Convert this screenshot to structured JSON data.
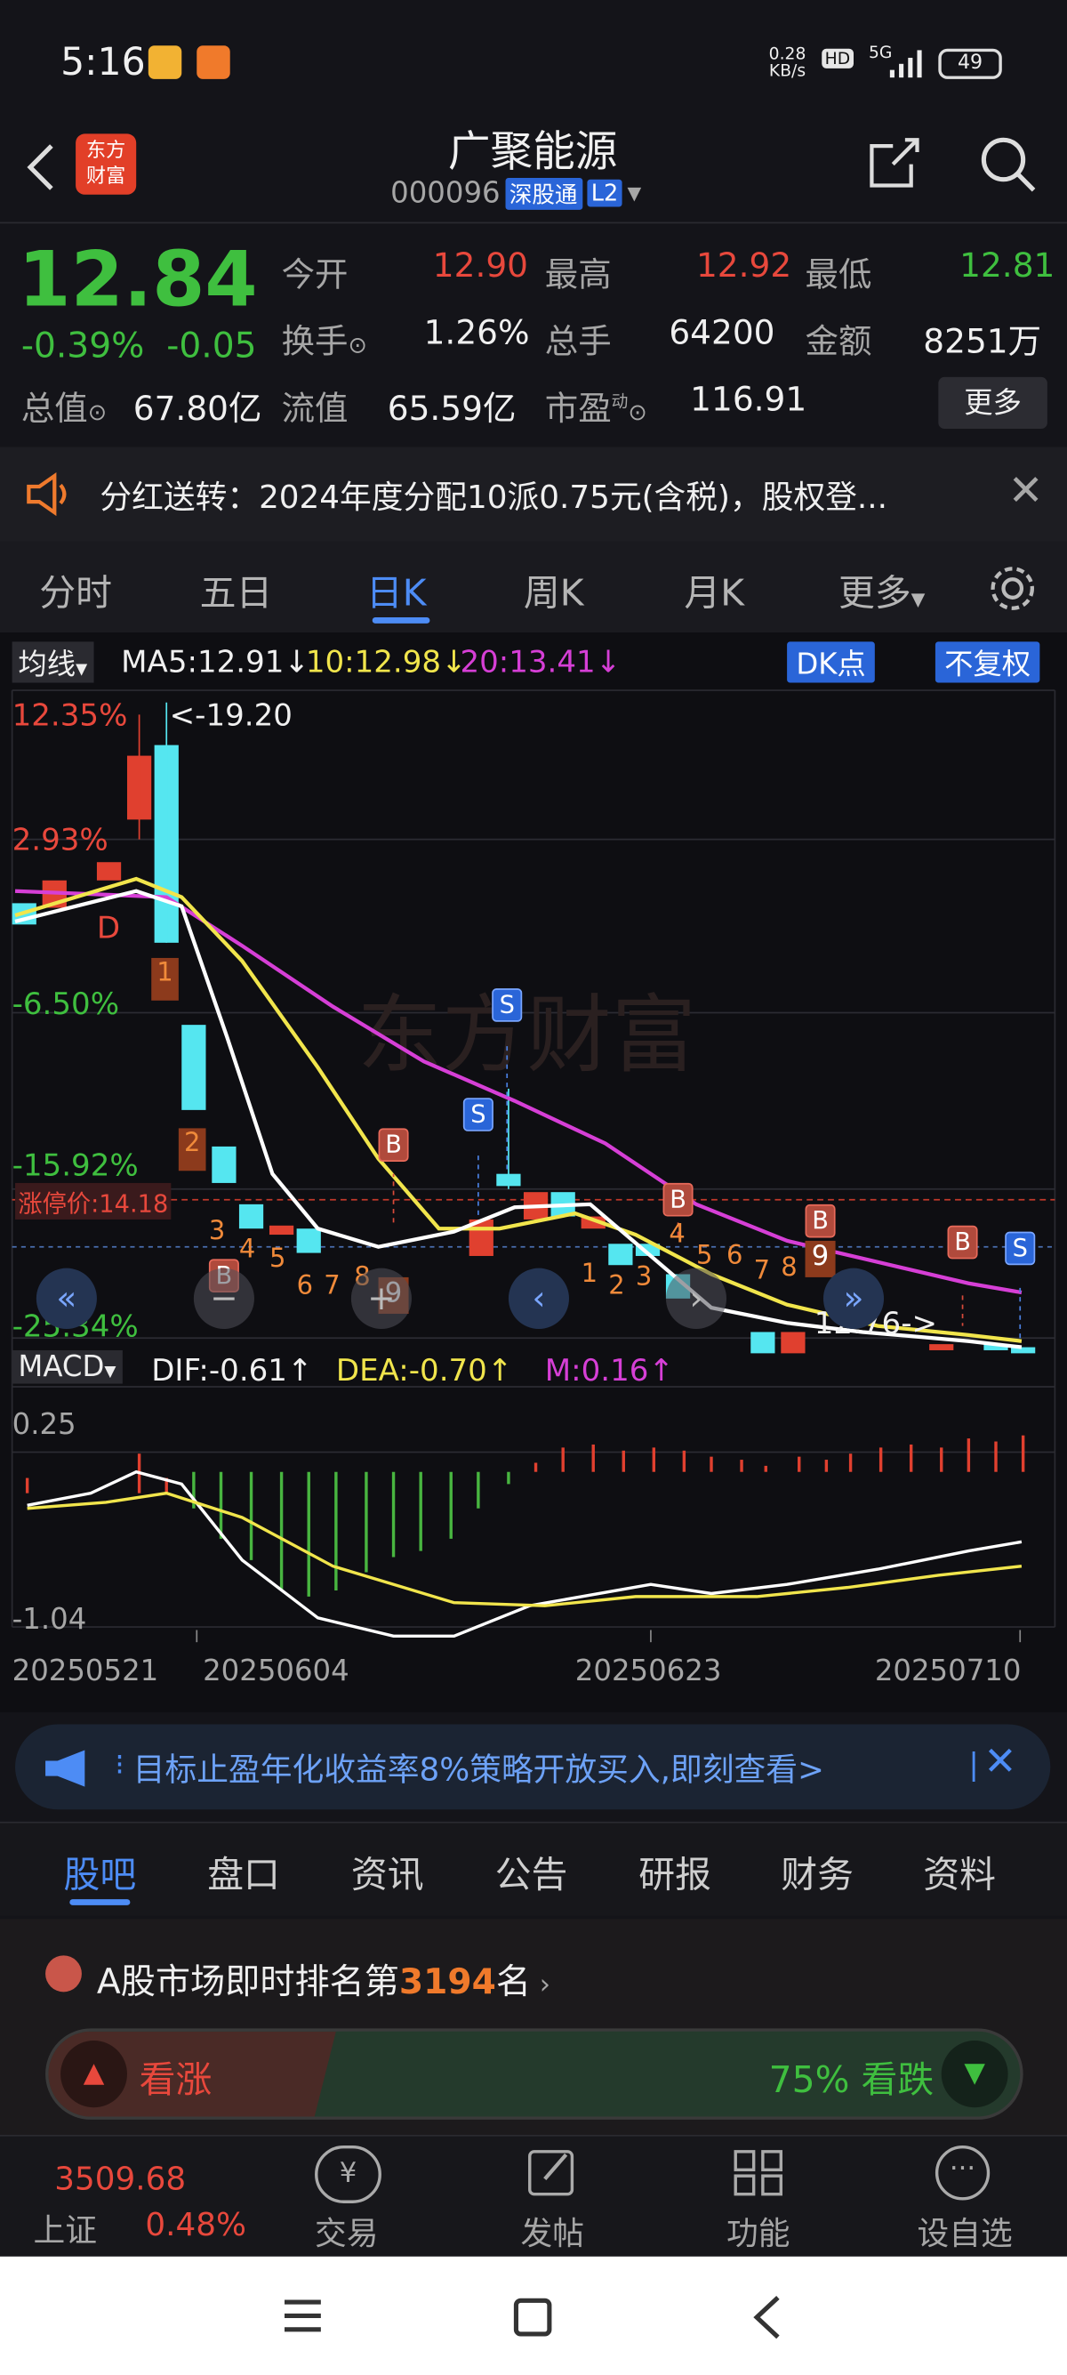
{
  "status": {
    "time": "5:16",
    "speed": "0.28",
    "speed_unit": "KB/s",
    "hd": "HD",
    "net": "5G",
    "battery": "49"
  },
  "header": {
    "title": "广聚能源",
    "code": "000096",
    "badge": "深股通",
    "level": "L2",
    "logo_line1": "东方",
    "logo_line2": "财富"
  },
  "quote": {
    "price": "12.84",
    "pct": "-0.39%",
    "chg": "-0.05",
    "open_l": "今开",
    "open_v": "12.90",
    "high_l": "最高",
    "high_v": "12.92",
    "low_l": "最低",
    "low_v": "12.81",
    "turn_l": "换手",
    "turn_v": "1.26%",
    "vol_l": "总手",
    "vol_v": "64200",
    "amt_l": "金额",
    "amt_v": "8251万",
    "mcap_l": "总值",
    "mcap_v": "67.80亿",
    "float_l": "流值",
    "float_v": "65.59亿",
    "pe_l": "市盈",
    "pe_sup": "动",
    "pe_v": "116.91",
    "more": "更多"
  },
  "notice": {
    "text": "分红送转：2024年度分配10派0.75元(含税)，股权登..."
  },
  "tabs": [
    "分时",
    "五日",
    "日K",
    "周K",
    "月K",
    "更多"
  ],
  "chart": {
    "ma_label": "均线",
    "ma5": "MA5:12.91↓",
    "ma10": "10:12.98↓",
    "ma20": "20:13.41↓",
    "dk": "DK点",
    "fq": "不复权",
    "pct_labels": [
      "12.35%",
      "2.93%",
      "-6.50%",
      "-15.92%",
      "-25.34%"
    ],
    "max_label": "<-19.20",
    "min_label": "12.76->",
    "limit_label": "涨停价:14.18",
    "watermark": "东方财富",
    "macd_label": "MACD",
    "dif": "DIF:-0.61↑",
    "dea": "DEA:-0.70↑",
    "m": "M:0.16↑",
    "macd_top": "0.25",
    "macd_bot": "-1.04",
    "dates": [
      "20250521",
      "20250604",
      "20250623",
      "20250710"
    ]
  },
  "chart_data": {
    "type": "candlestick",
    "indicator": "MACD",
    "ma": {
      "MA5": 12.91,
      "MA10": 12.98,
      "MA20": 13.41
    },
    "range_high": 19.2,
    "range_low": 12.76,
    "macd": {
      "DIF": -0.61,
      "DEA": -0.7,
      "M": 0.16
    }
  },
  "ad": {
    "text": "目标止盈年化收益率8%策略开放买入,即刻查看>"
  },
  "subtabs": [
    "股吧",
    "盘口",
    "资讯",
    "公告",
    "研报",
    "财务",
    "资料"
  ],
  "rank": {
    "prefix": "A股市场即时排名第",
    "num": "3194",
    "suffix": "名",
    "up": "看涨",
    "down": "75% 看跌"
  },
  "bottom": {
    "index_val": "3509.68",
    "index_name": "上证",
    "index_pct": "0.48%",
    "items": [
      "交易",
      "发帖",
      "功能",
      "设自选"
    ]
  }
}
